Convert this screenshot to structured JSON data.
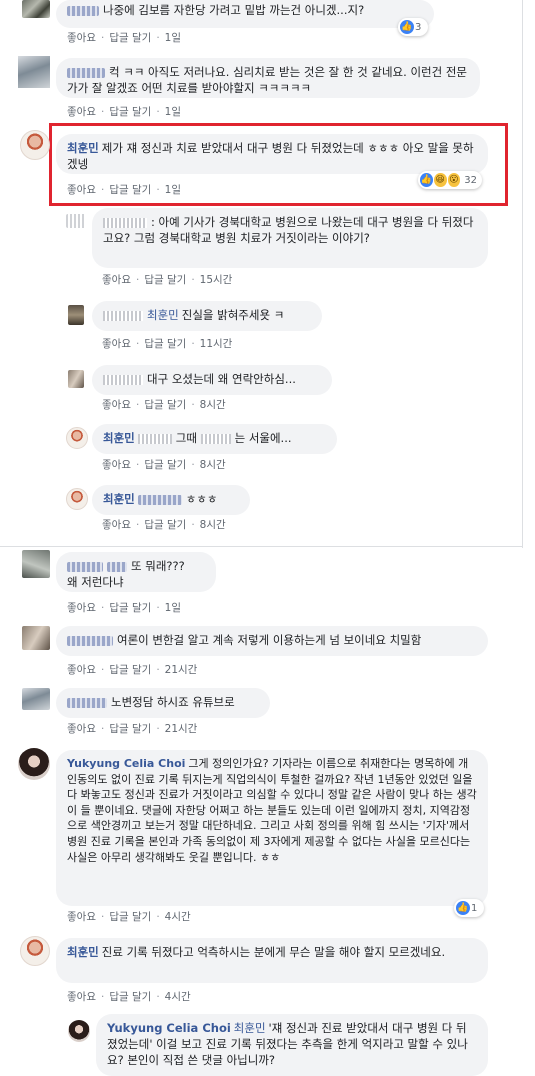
{
  "comments": [
    {
      "id": "c1",
      "name": "",
      "text": "나중에 김보름 자한당 가려고 밑밥 까는건 아니겠...지?",
      "like": "좋아요",
      "reply": "답글 달기",
      "time": "1일",
      "reactions": "3"
    },
    {
      "id": "c2",
      "name": "",
      "text": "컥 ㅋㅋ 아직도 저러나요. 심리치료 받는 것은 잘 한 것 같네요. 이런건 전문가가 잘 알겠죠 어떤 치료를 받아야할지 ㅋㅋㅋㅋㅋ",
      "like": "좋아요",
      "reply": "답글 달기",
      "time": "1일"
    },
    {
      "id": "c3",
      "name": "최훈민",
      "text": "제가 쟤 정신과 치료 받았대서 대구 병원 다 뒤졌었는데 ㅎㅎㅎ 아오 말을 못하겠넹",
      "like": "좋아요",
      "reply": "답글 달기",
      "time": "1일",
      "reactions": "32"
    },
    {
      "id": "r1",
      "name": "",
      "text": ": 아예 기사가 경북대학교 병원으로 나왔는데 대구 병원을 다 뒤졌다고요? 그럼 경북대학교 병원 치료가 거짓이라는 이야기?",
      "like": "좋아요",
      "reply": "답글 달기",
      "time": "15시간"
    },
    {
      "id": "r2",
      "name": "최훈민",
      "text": "진실을 밝혀주세욧 ㅋ",
      "like": "좋아요",
      "reply": "답글 달기",
      "time": "11시간"
    },
    {
      "id": "r3",
      "name": "",
      "text": "대구 오셨는데 왜 연락안하심...",
      "like": "좋아요",
      "reply": "답글 달기",
      "time": "8시간"
    },
    {
      "id": "r4",
      "name": "최훈민",
      "text_a": "그때",
      "text_b": "는 서울에...",
      "like": "좋아요",
      "reply": "답글 달기",
      "time": "8시간"
    },
    {
      "id": "r5",
      "name": "최훈민",
      "text": "ㅎㅎㅎ",
      "like": "좋아요",
      "reply": "답글 달기",
      "time": "8시간"
    },
    {
      "id": "c4",
      "name": "",
      "text": "또 뭐래???",
      "text2": "왜 저런다냐",
      "like": "좋아요",
      "reply": "답글 달기",
      "time": "1일"
    },
    {
      "id": "c5",
      "name": "",
      "text": "여론이 변한걸 알고 계속 저렇게 이용하는게 넘 보이네요 치밀함",
      "like": "좋아요",
      "reply": "답글 달기",
      "time": "21시간"
    },
    {
      "id": "c6",
      "name": "",
      "text": "노변정담 하시죠 유튜브로",
      "like": "좋아요",
      "reply": "답글 달기",
      "time": "21시간"
    },
    {
      "id": "c7",
      "name": "Yukyung Celia Choi",
      "text": "그게 정의인가요? 기자라는 이름으로 취재한다는 명목하에 개인동의도 없이 진료 기록 뒤지는게 직업의식이 투철한 걸까요? 작년 1년동안 있었던 일을 다 봐놓고도 정신과 진료가 거짓이라고 의심할 수 있다니 정말 같은 사람이 맞나 하는 생각이 들 뿐이네요. 댓글에 자한당 어쩌고 하는 분들도 있는데 이런 일에까지 정치, 지역감정으로 색안경끼고 보는거 정말 대단하네요. 그리고 사회 정의를 위해 힘 쓰시는 '기자'께서 병원 진료 기록을 본인과 가족 동의없이 제 3자에게 제공할 수 없다는 사실을 모르신다는 사실은 아무리 생각해봐도 웃길 뿐입니다. ㅎㅎ",
      "like": "좋아요",
      "reply": "답글 달기",
      "time": "4시간",
      "reactions": "1"
    },
    {
      "id": "c8",
      "name": "최훈민",
      "text": "진료 기록 뒤졌다고 억측하시는 분에게 무슨 말을 해야 할지 모르겠네요.",
      "like": "좋아요",
      "reply": "답글 달기",
      "time": "4시간"
    },
    {
      "id": "r6",
      "name": "Yukyung Celia Choi",
      "name2": "최훈민",
      "text": "'쟤 정신과 진료 받았대서 대구 병원 다 뒤졌었는데' 이걸 보고 진료 기록 뒤졌다는 추측을 한게 억지라고 말할 수 있나요? 본인이 직접 쓴 댓글 아닙니까?"
    }
  ],
  "colors": {
    "highlight": "#e0242f",
    "name": "#385898",
    "bubble": "#f2f3f5",
    "like": "#3b82f6"
  }
}
